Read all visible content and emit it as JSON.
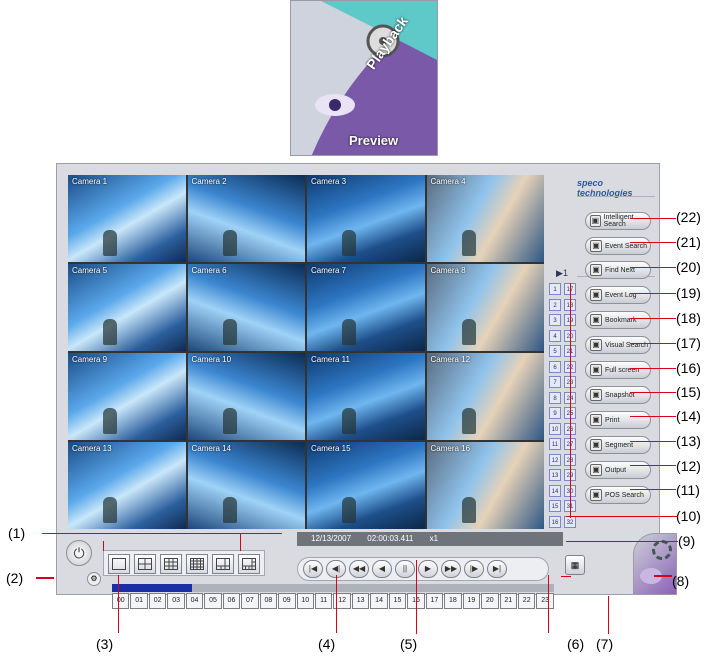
{
  "badge": {
    "preview_label": "Preview",
    "playback_label": "Playback"
  },
  "brand": {
    "logo_text": "speco technologies"
  },
  "cameras": [
    "Camera 1",
    "Camera 2",
    "Camera 3",
    "Camera 4",
    "Camera 5",
    "Camera 6",
    "Camera 7",
    "Camera 8",
    "Camera 9",
    "Camera 10",
    "Camera 11",
    "Camera 12",
    "Camera 13",
    "Camera 14",
    "Camera 15",
    "Camera 16"
  ],
  "channels": [
    "1",
    "2",
    "3",
    "4",
    "5",
    "6",
    "7",
    "8",
    "9",
    "10",
    "11",
    "12",
    "13",
    "14",
    "15",
    "16",
    "17",
    "18",
    "19",
    "20",
    "21",
    "22",
    "23",
    "24",
    "25",
    "26",
    "27",
    "28",
    "29",
    "30",
    "31",
    "32"
  ],
  "right_buttons": [
    {
      "label": "Intelligent Search",
      "icon": "intelligent-search-icon"
    },
    {
      "label": "Event Search",
      "icon": "event-search-icon"
    },
    {
      "label": "Find Next",
      "icon": "find-next-icon"
    },
    {
      "label": "Event Log",
      "icon": "event-log-icon"
    },
    {
      "label": "Bookmark",
      "icon": "bookmark-icon"
    },
    {
      "label": "Visual Search",
      "icon": "visual-search-icon"
    },
    {
      "label": "Full screen",
      "icon": "fullscreen-icon"
    },
    {
      "label": "Snapshot",
      "icon": "snapshot-icon"
    },
    {
      "label": "Print",
      "icon": "print-icon"
    },
    {
      "label": "Segment",
      "icon": "segment-icon"
    },
    {
      "label": "Output",
      "icon": "output-icon"
    },
    {
      "label": "POS Search",
      "icon": "pos-search-icon"
    }
  ],
  "status": {
    "datetime": "12/13/2007 02:00:03.411",
    "speed": "x1"
  },
  "hours": [
    "00",
    "01",
    "02",
    "03",
    "04",
    "05",
    "06",
    "07",
    "08",
    "09",
    "10",
    "11",
    "12",
    "13",
    "14",
    "15",
    "16",
    "17",
    "18",
    "19",
    "20",
    "21",
    "22",
    "23"
  ],
  "callouts": [
    "(1)",
    "(2)",
    "(3)",
    "(4)",
    "(5)",
    "(6)",
    "(7)",
    "(8)",
    "(9)",
    "(10)",
    "(11)",
    "(12)",
    "(13)",
    "(14)",
    "(15)",
    "(16)",
    "(17)",
    "(18)",
    "(19)",
    "(20)",
    "(21)",
    "(22)"
  ],
  "colors": {
    "callout_line": "#d9001b",
    "timeline_mark": "#1a2ea6"
  }
}
